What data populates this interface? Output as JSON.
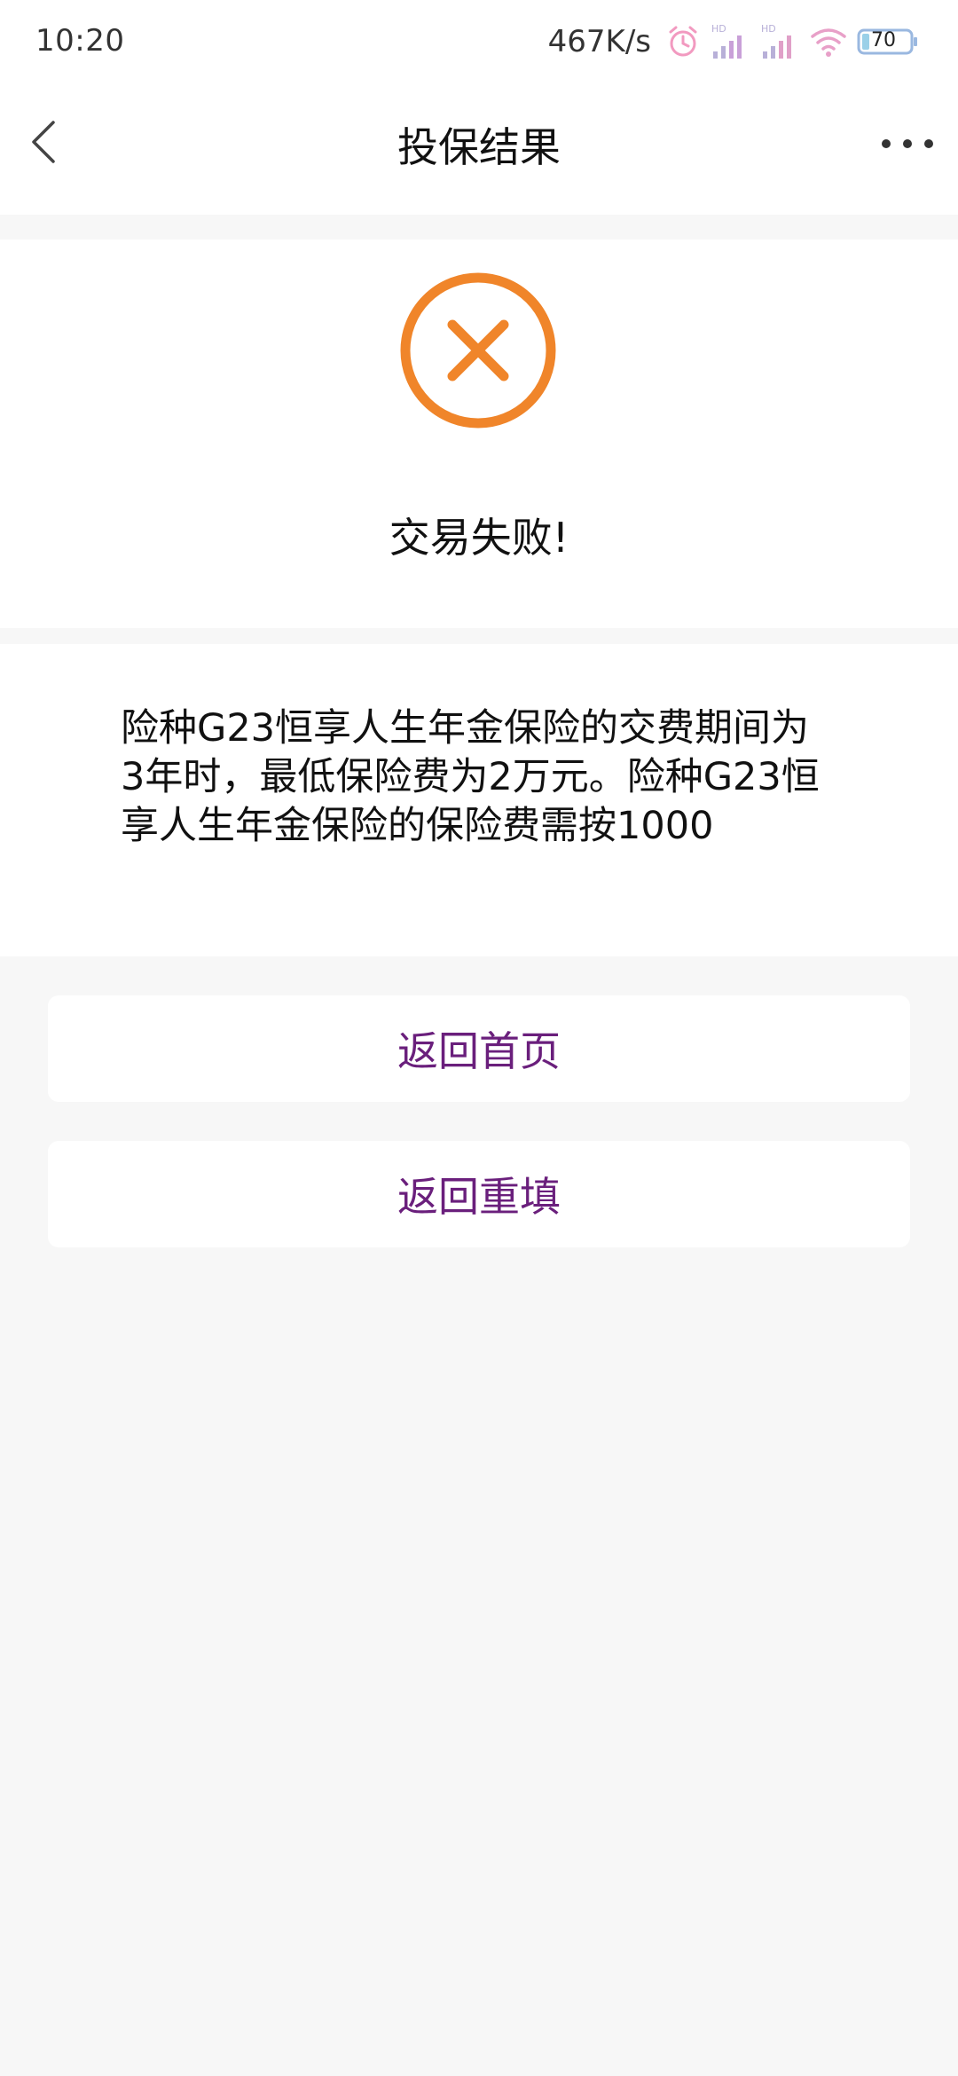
{
  "status_bar": {
    "time": "10:20",
    "net_speed": "467K/s",
    "battery": "70",
    "icons": [
      "alarm-icon",
      "signal-hd-icon",
      "signal-hd-icon",
      "wifi-icon",
      "battery-icon"
    ]
  },
  "nav": {
    "title": "投保结果",
    "back_icon": "chevron-left-icon",
    "more_icon": "more-dots-icon"
  },
  "result": {
    "icon": "close-circle-icon",
    "icon_color": "#f0852a",
    "text": "交易失败!"
  },
  "message": {
    "text": "险种G23恒享人生年金保险的交费期间为3年时，最低保险费为2万元。险种G23恒享人生年金保险的保险费需按1000"
  },
  "buttons": {
    "home_label": "返回首页",
    "refill_label": "返回重填",
    "label_color": "#6a1f7c"
  }
}
